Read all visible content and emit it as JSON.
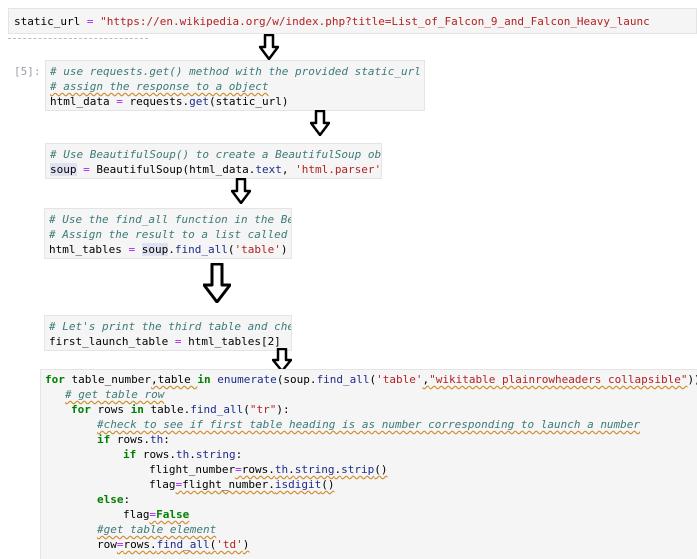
{
  "cell0": {
    "code": {
      "var": "static_url",
      "op": " = ",
      "str": "\"https://en.wikipedia.org/w/index.php?title=List_of_Falcon_9_and_Falcon_Heavy_launc"
    }
  },
  "cell1": {
    "prompt": "[5]:",
    "comment1": "# use requests.get() method with the provided static_url",
    "comment2": "# assign the response to a object",
    "code": {
      "var": "html_data",
      "op": " = ",
      "obj": "requests.",
      "fn": "get",
      "args": "(static_url)"
    }
  },
  "cell2": {
    "comment1": "# Use BeautifulSoup() to create a BeautifulSoup obje",
    "code": {
      "var": "soup",
      "op": " = ",
      "call": "BeautifulSoup(html_data.",
      "attr": "text",
      "sep": ", ",
      "str": "'html.parser'",
      "end": ")"
    }
  },
  "cell3": {
    "comment1": "# Use the find_all function in the Bea",
    "comment2": "# Assign the result to a list called `",
    "code": {
      "var": "html_tables",
      "op": " = ",
      "obj": "soup",
      "dot": ".",
      "fn": "find_all",
      "open": "(",
      "str": "'table'",
      "close": ")"
    }
  },
  "cell4": {
    "comment1": "# Let's print the third table and chec",
    "code": {
      "var": "first_launch_table",
      "op": " = ",
      "rest": "html_tables[2]"
    }
  },
  "cell5": {
    "l1": {
      "kw1": "for",
      "a": " table_number",
      "b": ",table ",
      "kw2": "in",
      "c": " ",
      "fn1": "enumerate",
      "d": "(soup.",
      "fn2": "find_all",
      "e": "(",
      "s1": "'table'",
      "f": ",",
      "s2": "\"wikitable plainrowheaders collapsible\"",
      "g": ")):"
    },
    "l2": "# get table row",
    "l3": {
      "kw1": "for",
      "a": " rows ",
      "kw2": "in",
      "b": " table.",
      "fn": "find_all",
      "c": "(",
      "s": "\"tr\"",
      "d": "):"
    },
    "l4": "#check to see if first table heading is as number corresponding to launch a number",
    "l5": {
      "kw": "if",
      "a": " rows.",
      "fn": "th",
      "b": ":"
    },
    "l6": {
      "kw": "if",
      "a": " rows.",
      "fn1": "th",
      "b": ".",
      "fn2": "string",
      "c": ":"
    },
    "l7": {
      "a": "flight_number",
      "op": "=",
      "b": "rows.",
      "fn1": "th",
      "c": ".",
      "fn2": "string",
      "d": ".",
      "fn3": "strip",
      "e": "()"
    },
    "l8": {
      "a": "flag",
      "op": "=",
      "b": "flight_number.",
      "fn": "isdigit",
      "c": "()"
    },
    "l9": {
      "kw": "else",
      "a": ":"
    },
    "l10": {
      "a": "flag",
      "op": "=",
      "kw": "False"
    },
    "l11": "#get table element",
    "l12": {
      "a": "row",
      "op": "=",
      "b": "rows.",
      "fn": "find_all",
      "c": "(",
      "s": "'td'",
      "d": ")"
    }
  },
  "colors": {
    "comment": "#3d7a7a",
    "keyword": "#008000",
    "string": "#b22222",
    "operator": "#aa22ff",
    "cell_bg": "#f5f5f5",
    "selection": "#dfe3f1"
  },
  "icons": {
    "arrow": "down-arrow-icon"
  }
}
